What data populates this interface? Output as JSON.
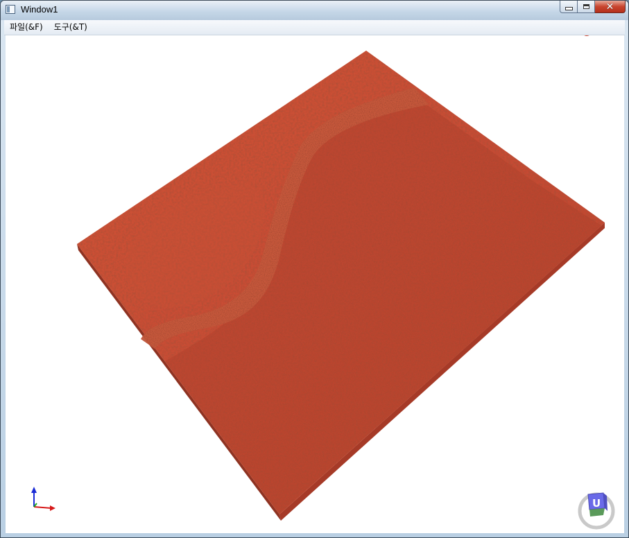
{
  "window": {
    "title": "Window1",
    "icon": "app-window-icon",
    "controls": [
      {
        "name": "minimize-button",
        "icon": "minimize-icon"
      },
      {
        "name": "maximize-button",
        "icon": "maximize-icon"
      },
      {
        "name": "close-button",
        "icon": "close-icon",
        "glyph": "✕"
      }
    ]
  },
  "menu": {
    "items": [
      {
        "label": "파일(&F)"
      },
      {
        "label": "도구(&T)"
      }
    ]
  },
  "viewport": {
    "content": "3d-terrain-surface",
    "terrain_color": "#c44a33",
    "river_color": "#c85a3e",
    "background": "#ffffff",
    "axis_triad_icon": "axis-triad-icon",
    "view_cube_icon": "view-cube-icon",
    "view_cube_label": "U",
    "view_cube_color": "#6a6ae8"
  }
}
